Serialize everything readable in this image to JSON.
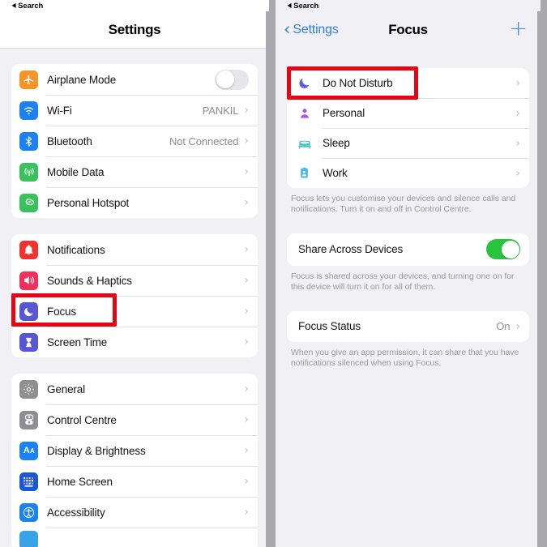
{
  "statusbar": {
    "back_label": "Search"
  },
  "left_screen": {
    "nav": {
      "title": "Settings"
    },
    "groups": [
      {
        "id": "connectivity",
        "rows": [
          {
            "label": "Airplane Mode",
            "icon": "airplane-icon",
            "icon_color": "#f39625",
            "control": "toggle",
            "toggle_on": false
          },
          {
            "label": "Wi-Fi",
            "icon": "wifi-icon",
            "icon_color": "#1a82f1",
            "value": "PANKIL",
            "control": "chevron"
          },
          {
            "label": "Bluetooth",
            "icon": "bluetooth-icon",
            "icon_color": "#1a82f1",
            "value": "Not Connected",
            "control": "chevron"
          },
          {
            "label": "Mobile Data",
            "icon": "cellular-icon",
            "icon_color": "#39c15c",
            "value": "",
            "control": "chevron"
          },
          {
            "label": "Personal Hotspot",
            "icon": "hotspot-icon",
            "icon_color": "#39c15c",
            "value": "",
            "control": "chevron"
          }
        ]
      },
      {
        "id": "alerts",
        "rows": [
          {
            "label": "Notifications",
            "icon": "bell-icon",
            "icon_color": "#f2322e",
            "value": "",
            "control": "chevron"
          },
          {
            "label": "Sounds & Haptics",
            "icon": "speaker-icon",
            "icon_color": "#f0315b",
            "value": "",
            "control": "chevron"
          },
          {
            "label": "Focus",
            "icon": "moon-icon",
            "icon_color": "#5756d5",
            "value": "",
            "control": "chevron",
            "highlighted": true
          },
          {
            "label": "Screen Time",
            "icon": "hourglass-icon",
            "icon_color": "#5756d5",
            "value": "",
            "control": "chevron"
          }
        ]
      },
      {
        "id": "system",
        "rows": [
          {
            "label": "General",
            "icon": "gear-icon",
            "icon_color": "#8e8e93",
            "value": "",
            "control": "chevron"
          },
          {
            "label": "Control Centre",
            "icon": "control-centre-icon",
            "icon_color": "#8e8e93",
            "value": "",
            "control": "chevron"
          },
          {
            "label": "Display & Brightness",
            "icon": "display-brightness-icon",
            "icon_color": "#1a82f1",
            "value": "",
            "control": "chevron"
          },
          {
            "label": "Home Screen",
            "icon": "home-screen-icon",
            "icon_color": "#1758d4",
            "value": "",
            "control": "chevron"
          },
          {
            "label": "Accessibility",
            "icon": "accessibility-icon",
            "icon_color": "#1a82f1",
            "value": "",
            "control": "chevron"
          },
          {
            "label": "",
            "icon": "partial-icon",
            "icon_color": "#3aa3e8",
            "value": "",
            "control": "none"
          }
        ]
      }
    ]
  },
  "right_screen": {
    "nav": {
      "back_label": "Settings",
      "title": "Focus",
      "add_label": "+"
    },
    "focus_modes": [
      {
        "label": "Do Not Disturb",
        "icon": "moon-glyph-icon",
        "icon_color": "#6361d8",
        "highlighted": true
      },
      {
        "label": "Personal",
        "icon": "person-glyph-icon",
        "icon_color": "#b057e0"
      },
      {
        "label": "Sleep",
        "icon": "bed-glyph-icon",
        "icon_color": "#46c4c4"
      },
      {
        "label": "Work",
        "icon": "badge-glyph-icon",
        "icon_color": "#49b9e8"
      }
    ],
    "focus_footnote": "Focus lets you customise your devices and silence calls and notifications. Turn it on and off in Control Centre.",
    "share_across_devices": {
      "label": "Share Across Devices",
      "toggle_on": true
    },
    "share_footnote": "Focus is shared across your devices, and turning one on for this device will turn it on for all of them.",
    "focus_status": {
      "label": "Focus Status",
      "value": "On"
    },
    "status_footnote": "When you give an app permission, it can share that you have notifications silenced when using Focus."
  },
  "colors": {
    "highlight": "#e30613",
    "accent_blue": "#2f7fd8",
    "toggle_on": "#28c440",
    "page_bg": "#f1f1f5",
    "frame_bg": "#a9a9ad"
  }
}
